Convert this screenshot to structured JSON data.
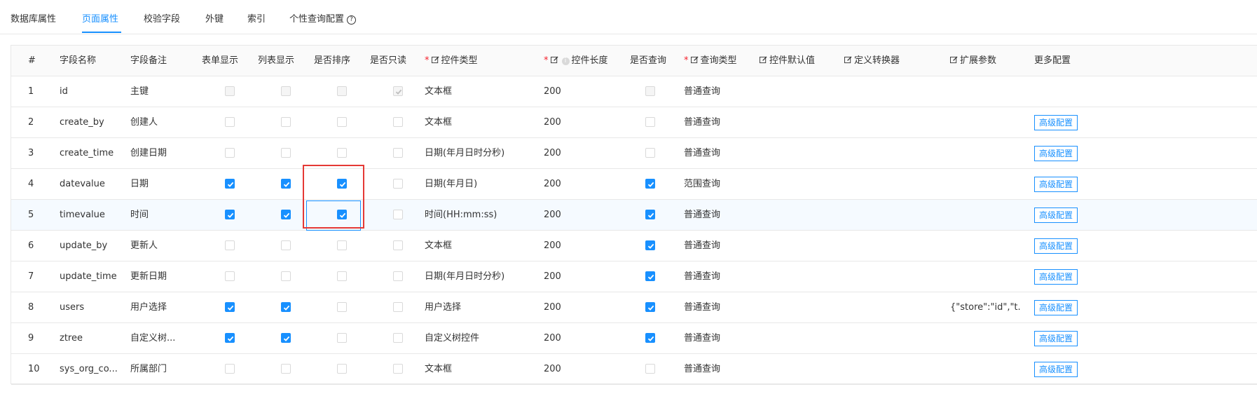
{
  "tabs": [
    {
      "label": "数据库属性",
      "active": false
    },
    {
      "label": "页面属性",
      "active": true
    },
    {
      "label": "校验字段",
      "active": false
    },
    {
      "label": "外键",
      "active": false
    },
    {
      "label": "索引",
      "active": false
    },
    {
      "label": "个性查询配置",
      "active": false
    }
  ],
  "columns": {
    "index": "#",
    "field_name": "字段名称",
    "field_remark": "字段备注",
    "form_show": "表单显示",
    "list_show": "列表显示",
    "is_sort": "是否排序",
    "is_readonly": "是否只读",
    "control_type": "控件类型",
    "control_length": "控件长度",
    "is_query": "是否查询",
    "query_type": "查询类型",
    "control_default": "控件默认值",
    "dict_converter": "定义转换器",
    "ext_params": "扩展参数",
    "more_config": "更多配置"
  },
  "required_mark": "*",
  "icons": {
    "edit": "edit-icon",
    "info": "info-circle-icon",
    "help": "question-circle-icon",
    "check": "checkmark-icon"
  },
  "accent": "#1890ff",
  "advanced_button_label": "高级配置",
  "rows": [
    {
      "index": "1",
      "field_name": "id",
      "field_remark": "主键",
      "form_show": false,
      "list_show": false,
      "is_sort": false,
      "is_readonly": true,
      "control_type": "文本框",
      "control_length": "200",
      "is_query": false,
      "query_type": "普通查询",
      "ext_params": "",
      "disabled": true,
      "has_advanced": false
    },
    {
      "index": "2",
      "field_name": "create_by",
      "field_remark": "创建人",
      "form_show": false,
      "list_show": false,
      "is_sort": false,
      "is_readonly": false,
      "control_type": "文本框",
      "control_length": "200",
      "is_query": false,
      "query_type": "普通查询",
      "ext_params": "",
      "disabled": false,
      "has_advanced": true
    },
    {
      "index": "3",
      "field_name": "create_time",
      "field_remark": "创建日期",
      "form_show": false,
      "list_show": false,
      "is_sort": false,
      "is_readonly": false,
      "control_type": "日期(年月日时分秒)",
      "control_length": "200",
      "is_query": false,
      "query_type": "普通查询",
      "ext_params": "",
      "disabled": false,
      "has_advanced": true
    },
    {
      "index": "4",
      "field_name": "datevalue",
      "field_remark": "日期",
      "form_show": true,
      "list_show": true,
      "is_sort": true,
      "is_readonly": false,
      "control_type": "日期(年月日)",
      "control_length": "200",
      "is_query": true,
      "query_type": "范围查询",
      "ext_params": "",
      "disabled": false,
      "has_advanced": true
    },
    {
      "index": "5",
      "field_name": "timevalue",
      "field_remark": "时间",
      "form_show": true,
      "list_show": true,
      "is_sort": true,
      "is_readonly": false,
      "control_type": "时间(HH:mm:ss)",
      "control_length": "200",
      "is_query": true,
      "query_type": "普通查询",
      "ext_params": "",
      "disabled": false,
      "has_advanced": true
    },
    {
      "index": "6",
      "field_name": "update_by",
      "field_remark": "更新人",
      "form_show": false,
      "list_show": false,
      "is_sort": false,
      "is_readonly": false,
      "control_type": "文本框",
      "control_length": "200",
      "is_query": true,
      "query_type": "普通查询",
      "ext_params": "",
      "disabled": false,
      "has_advanced": true
    },
    {
      "index": "7",
      "field_name": "update_time",
      "field_remark": "更新日期",
      "form_show": false,
      "list_show": false,
      "is_sort": false,
      "is_readonly": false,
      "control_type": "日期(年月日时分秒)",
      "control_length": "200",
      "is_query": true,
      "query_type": "普通查询",
      "ext_params": "",
      "disabled": false,
      "has_advanced": true
    },
    {
      "index": "8",
      "field_name": "users",
      "field_remark": "用户选择",
      "form_show": true,
      "list_show": true,
      "is_sort": false,
      "is_readonly": false,
      "control_type": "用户选择",
      "control_length": "200",
      "is_query": true,
      "query_type": "普通查询",
      "ext_params": "{\"store\":\"id\",\"t...",
      "disabled": false,
      "has_advanced": true
    },
    {
      "index": "9",
      "field_name": "ztree",
      "field_remark": "自定义树...",
      "form_show": true,
      "list_show": true,
      "is_sort": false,
      "is_readonly": false,
      "control_type": "自定义树控件",
      "control_length": "200",
      "is_query": true,
      "query_type": "普通查询",
      "ext_params": "",
      "disabled": false,
      "has_advanced": true
    },
    {
      "index": "10",
      "field_name": "sys_org_co...",
      "field_remark": "所属部门",
      "form_show": false,
      "list_show": false,
      "is_sort": false,
      "is_readonly": false,
      "control_type": "文本框",
      "control_length": "200",
      "is_query": false,
      "query_type": "普通查询",
      "ext_params": "",
      "disabled": false,
      "has_advanced": true
    }
  ]
}
